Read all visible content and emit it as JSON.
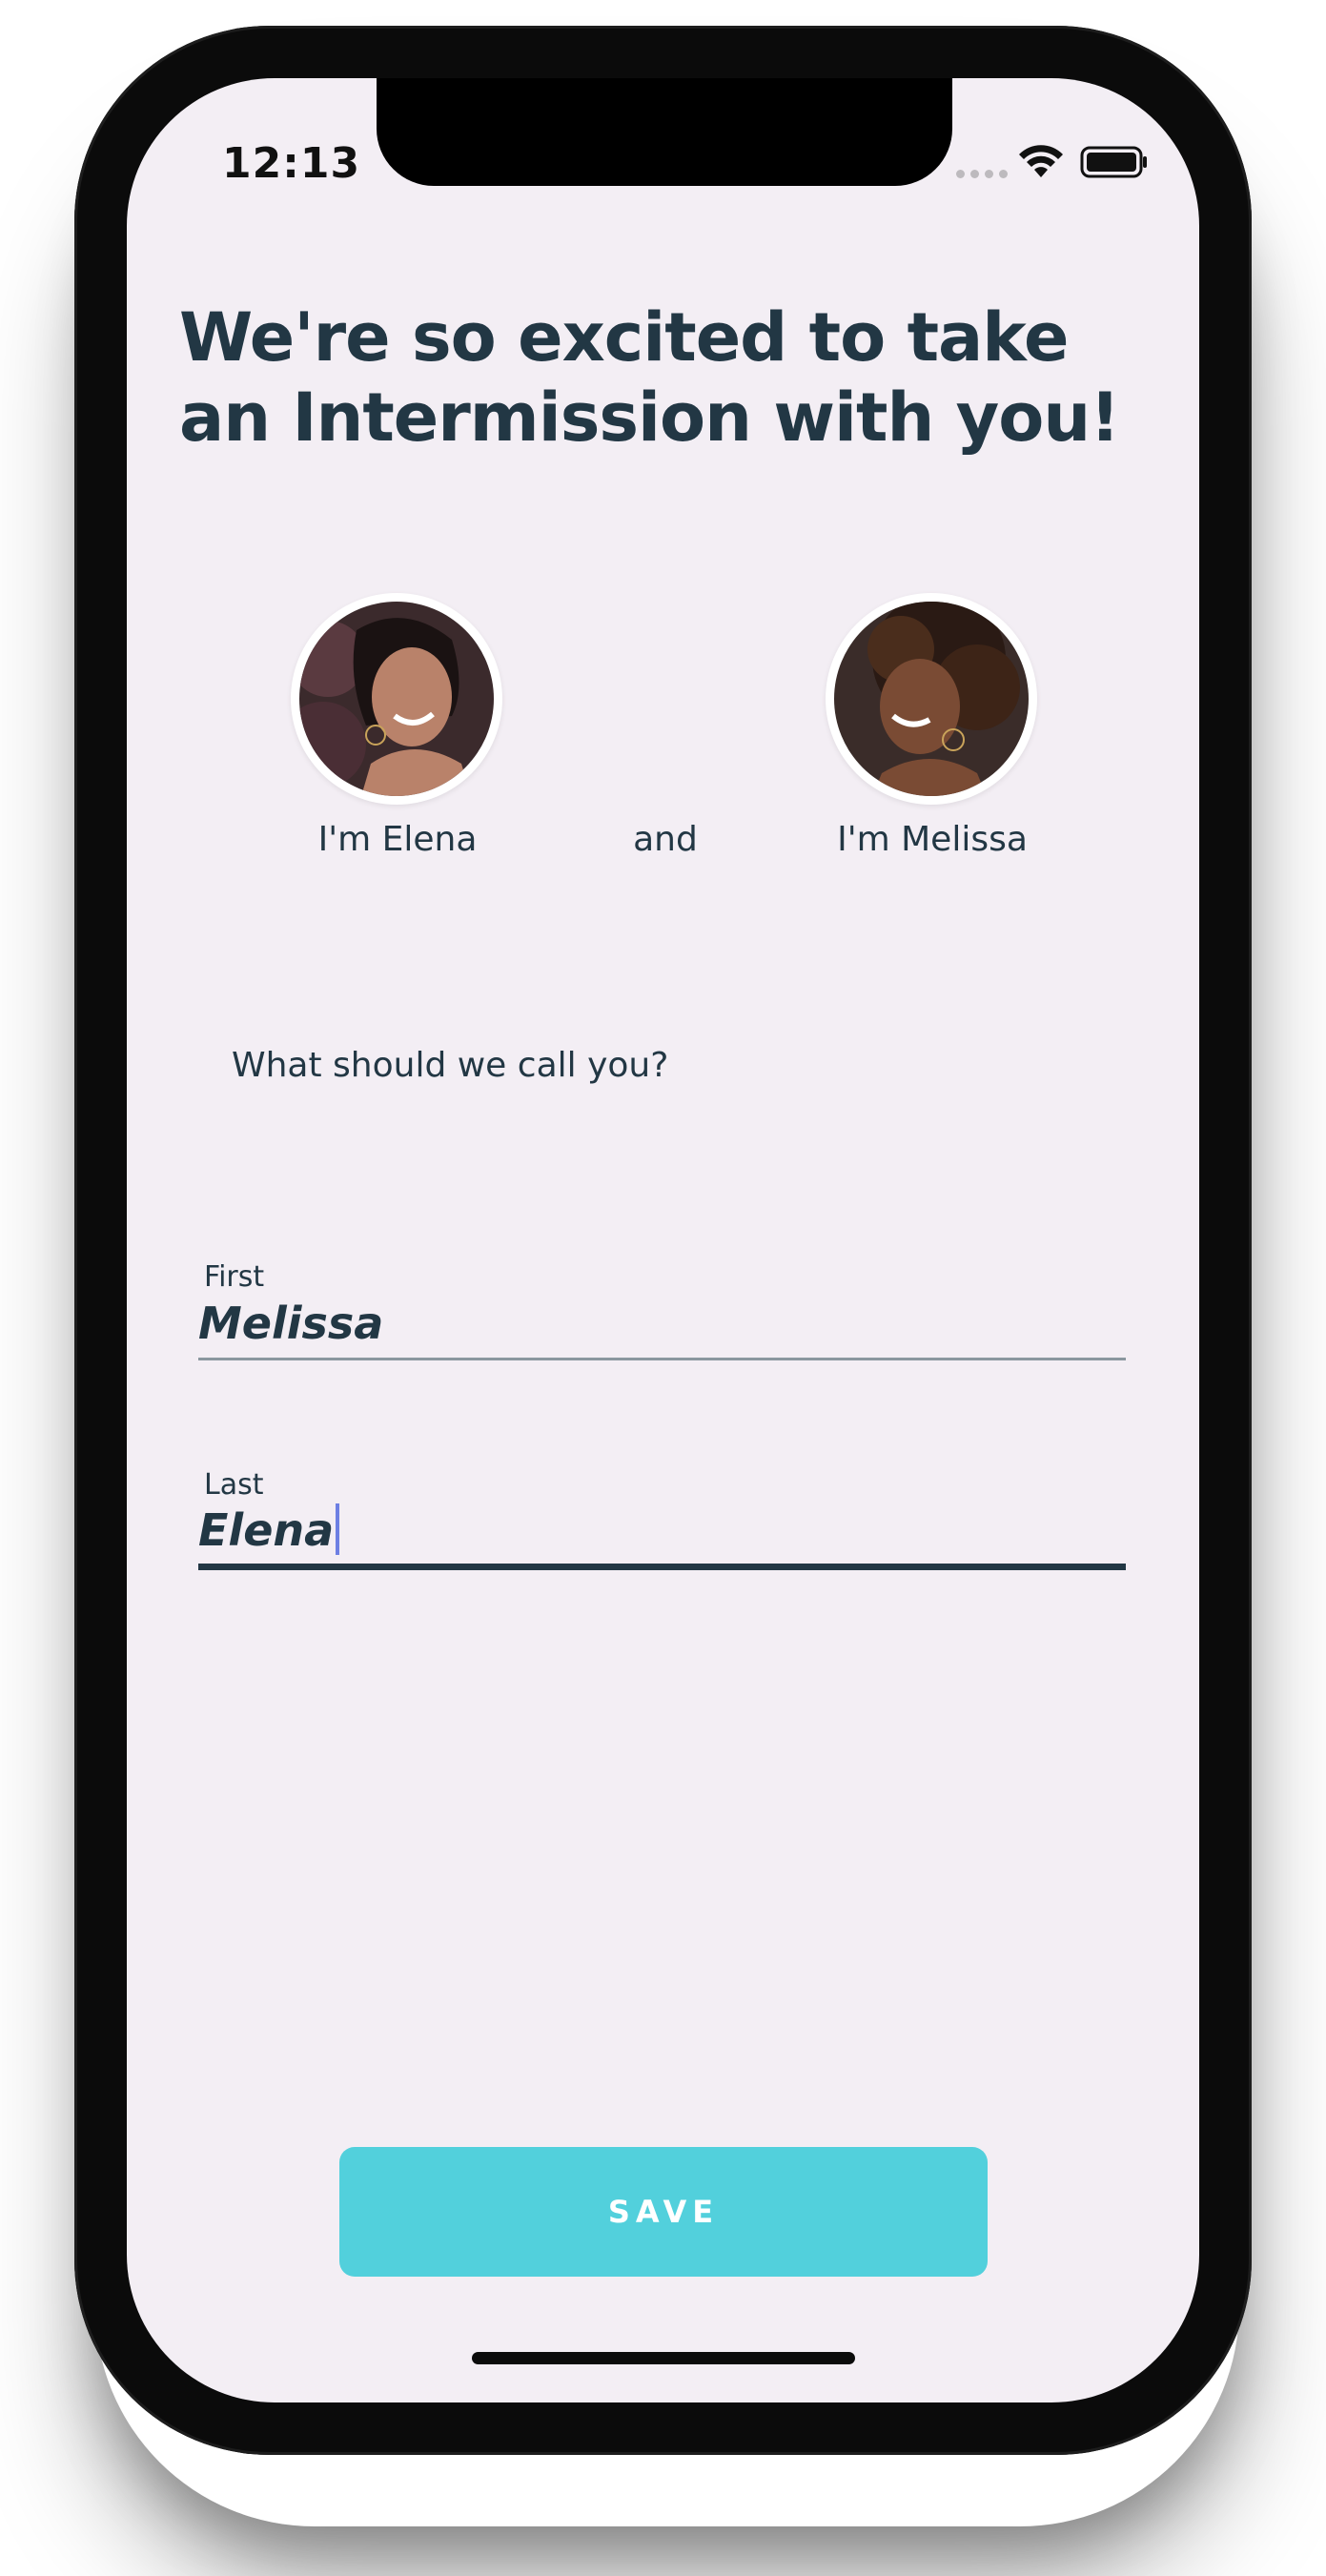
{
  "status_bar": {
    "time": "12:13",
    "wifi_icon": "wifi-icon",
    "battery_icon": "battery-icon"
  },
  "heading": "We're so excited to take an Intermission with you!",
  "hosts": {
    "left": {
      "label": "I'm Elena",
      "avatar_icon": "avatar-elena"
    },
    "connector": "and",
    "right": {
      "label": "I'm Melissa",
      "avatar_icon": "avatar-melissa"
    }
  },
  "question": "What should we call you?",
  "form": {
    "first": {
      "label": "First",
      "value": "Melissa"
    },
    "last": {
      "label": "Last",
      "value": "Elena"
    }
  },
  "save_button": {
    "label": "SAVE"
  },
  "colors": {
    "background": "#f3eef4",
    "text": "#223744",
    "accent": "#52d0dc",
    "caret": "#6d7fe3"
  }
}
